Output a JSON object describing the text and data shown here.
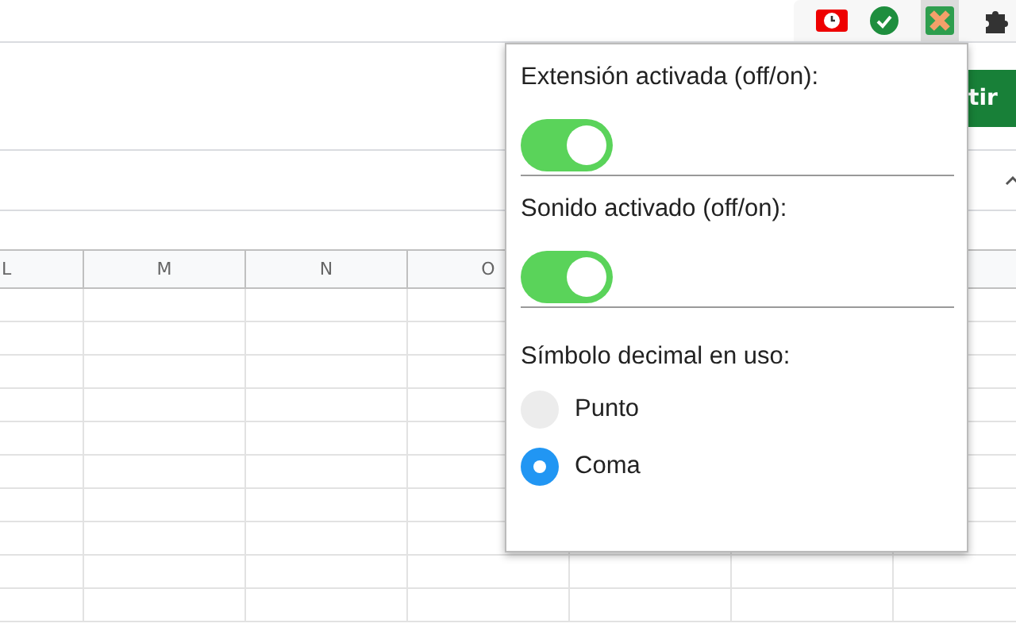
{
  "spreadsheet": {
    "share_button": "tir",
    "columns": [
      "L",
      "M",
      "N",
      "O"
    ]
  },
  "popup": {
    "toggles": [
      {
        "label": "Extensión activada (off/on):",
        "on": true
      },
      {
        "label": "Sonido activado (off/on):",
        "on": true
      }
    ],
    "decimal_label": "Símbolo decimal en uso:",
    "options": [
      {
        "label": "Punto",
        "selected": false
      },
      {
        "label": "Coma",
        "selected": true
      }
    ]
  }
}
